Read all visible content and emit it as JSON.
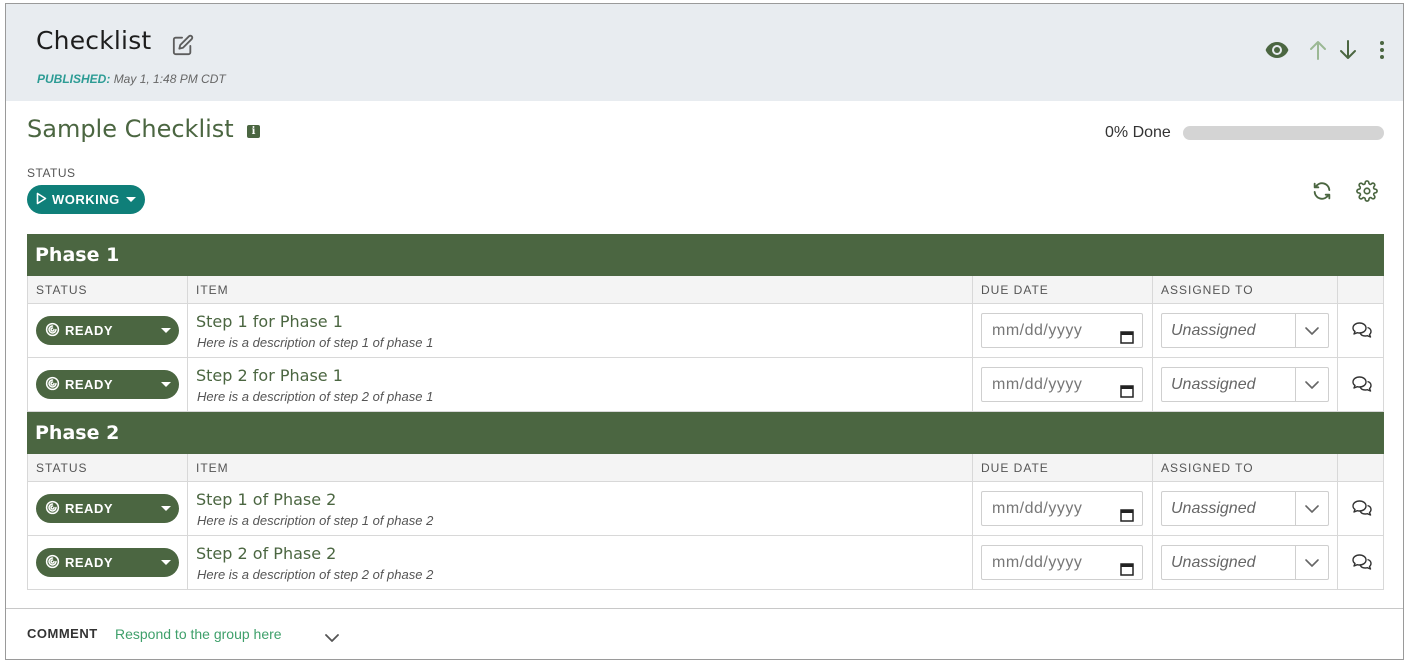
{
  "header": {
    "title": "Checklist",
    "published_label": "PUBLISHED:",
    "published_date": "May 1, 1:48 PM CDT"
  },
  "checklist": {
    "title": "Sample Checklist",
    "info_glyph": "i",
    "progress_label": "0% Done",
    "progress_fraction": 0,
    "status_label": "STATUS",
    "status_value": "WORKING"
  },
  "columns": {
    "status": "STATUS",
    "item": "ITEM",
    "due_date": "DUE DATE",
    "assigned_to": "ASSIGNED TO"
  },
  "phases": [
    {
      "name": "Phase 1",
      "steps": [
        {
          "status": "READY",
          "name": "Step 1 for Phase 1",
          "description": "Here is a description of step 1 of phase 1",
          "due_placeholder": "mm/dd/yyyy",
          "assigned": "Unassigned"
        },
        {
          "status": "READY",
          "name": "Step 2 for Phase 1",
          "description": "Here is a description of step 2 of phase 1",
          "due_placeholder": "mm/dd/yyyy",
          "assigned": "Unassigned"
        }
      ]
    },
    {
      "name": "Phase 2",
      "steps": [
        {
          "status": "READY",
          "name": "Step 1 of Phase 2",
          "description": "Here is a description of step 1 of phase 2",
          "due_placeholder": "mm/dd/yyyy",
          "assigned": "Unassigned"
        },
        {
          "status": "READY",
          "name": "Step 2 of Phase 2",
          "description": "Here is a description of step 2 of phase 2",
          "due_placeholder": "mm/dd/yyyy",
          "assigned": "Unassigned"
        }
      ]
    }
  ],
  "comment": {
    "label": "COMMENT",
    "link": "Respond to the group here"
  },
  "icons": {
    "edit": "edit-pencil-icon",
    "view": "eye-icon",
    "up": "arrow-up-icon",
    "down": "arrow-down-icon",
    "more": "more-vertical-icon",
    "refresh": "refresh-icon",
    "settings": "gear-icon",
    "ready": "ready-status-icon",
    "calendar": "calendar-icon",
    "comment": "comment-bubble-icon"
  },
  "colors": {
    "header_bg": "#e8ecf0",
    "brand_green": "#4b6641",
    "teal": "#0f7f79",
    "published_teal": "#2d9c95",
    "link_green": "#3fa06b"
  }
}
